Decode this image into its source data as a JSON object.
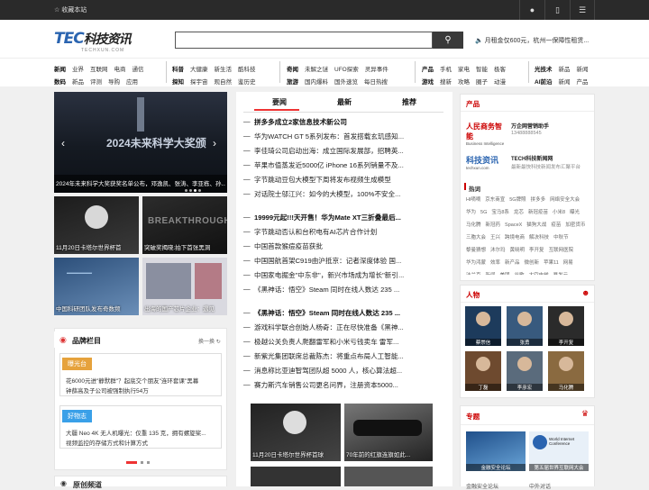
{
  "topbar": {
    "fav": "☆ 收藏本站",
    "wechat_icon": "wechat-icon",
    "mobile_icon": "mobile-icon",
    "menu_icon": "menu-icon"
  },
  "header": {
    "logo_tec": "TEC",
    "logo_cn": "科技资讯",
    "logo_small": "TECHXUN.COM",
    "search_placeholder": "",
    "notice": "月租金仅600元，杭州一保障性租赁..."
  },
  "nav": {
    "row1a": [
      "新闻",
      "业界",
      "互联网",
      "电商",
      "通信"
    ],
    "row2a": [
      "数码",
      "新品",
      "评测",
      "导购",
      "应用"
    ],
    "row1b": [
      "科普",
      "大健康",
      "新生活",
      "酷科技"
    ],
    "row2b": [
      "探知",
      "探宇宙",
      "观自然",
      "鉴历史"
    ],
    "row1c": [
      "奇闻",
      "未解之谜",
      "UFO探索",
      "灵异事件"
    ],
    "row2c": [
      "旅游",
      "国内爆料",
      "国外速览",
      "每日热搜"
    ],
    "row1d": [
      "产品",
      "手机",
      "家电",
      "智能",
      "极客"
    ],
    "row2d": [
      "游戏",
      "搜新",
      "攻略",
      "圈子",
      "动漫"
    ],
    "row1e": [
      "光技术",
      "新品",
      "新闻"
    ],
    "row2e": [
      "AI前沿",
      "新闻",
      "产品"
    ]
  },
  "carousel": {
    "bigtext": "2024未来科学大奖颁",
    "caption": "2024年未来科学大奖获奖名单公布，邓逸凯、张涛、李亚栋、孙..."
  },
  "thumbs": [
    {
      "cap": "11月20日卡塔尔世界杯首"
    },
    {
      "cap": "突破奖揭晓:拍下首张黑洞"
    },
    {
      "cap": "中国科研团队发布奇数频"
    },
    {
      "cap": "出海的国产芯片企业：遇见"
    }
  ],
  "brand": {
    "title": "品牌栏目",
    "switch": "换一换",
    "boxes": [
      {
        "tag": "曝光台",
        "lines": [
          "花6000元进\"静默群\"？起底交个朋友\"连环套课\"黑幕",
          "钟薛高及子公司被强制执行54万"
        ]
      },
      {
        "tag": "好物志",
        "lines": [
          "大疆 Neo 4K 无人机曝光：仅重 135 克，拥有螺旋桨...",
          "视频监控的存储方式和计算方式"
        ]
      }
    ],
    "next": "原创频道"
  },
  "tabs": [
    "要闻",
    "最新",
    "推荐"
  ],
  "news1": [
    "拼多多成立2家信息技术新公司",
    "华为WATCH GT 5系列发布：首发搭载玄玑感知...",
    "李佳琦公司启动出海：成立国际发展部，招聘英...",
    "苹果市值蒸发近5000亿 iPhone 16系列销量不及...",
    "字节跳动豆包大模型下周将发布视频生成模型",
    "对话院士邬江兴：如今的大模型，100%不安全..."
  ],
  "news2": [
    "19999元起!!!天开售！华为Mate XT三折叠最后...",
    "字节跳动否认和台积电有AI芯片合作计划",
    "中国首款猴痘疫苗获批",
    "中国国航首架C919由沪抵京：记者深度体验 国...",
    "中国家电掘金\"中东非\"，新兴市场成为增长\"新引...",
    "《黑神话：悟空》Steam 同时在线人数达 235 ..."
  ],
  "news3": [
    "《黑神话：悟空》Steam 同时在线人数达 235 ...",
    "游戏科学联合创始人杨奇：正在尽快准备《黑神...",
    "极越公关负责人爬翻雷军和小米亏钱卖车 雷军...",
    "新紫光集团联席总裁陈杰：将重点布局人工智能...",
    "消息称比亚迪智驾团队超 5000 人，核心算法超...",
    "赛力斯汽车销售公司更名问界，注册资本5000..."
  ],
  "bottomthumbs": [
    {
      "cap": "11月20日卡塔尔世界杯首球"
    },
    {
      "cap": "70年前的红旗连旗如此..."
    }
  ],
  "right": {
    "product": "产品",
    "p1name": "万企网营销助手",
    "p1desc": "13488888545",
    "p1logo": "人民商务智能",
    "p1sub": "Business Intelligence",
    "p2name": "TECH科技新闻网",
    "p2desc": "最新最快科技新闻发布汇聚平台",
    "p2logo": "科技资讯",
    "hottitle": "热词",
    "tags": [
      "Hi嘀嘀",
      "京东商宣",
      "5G牌照",
      "拼多多",
      "网络安全大会",
      "华为",
      "5G",
      "宝马8系",
      "龙芯",
      "新冠疫苗",
      "小米8",
      "曝光",
      "马化腾",
      "新冠药",
      "SpaceX",
      "猫狗大战",
      "疫苗",
      "加密货币",
      "三胞大会",
      "王兴",
      "跨境电商",
      "解决科技",
      "中秋节",
      "黎曼猜想",
      "沐尔玛",
      "黄晓明",
      "李开复",
      "互联网医院",
      "华为鸿蒙",
      "效率",
      "新产品",
      "微创新",
      "苹果11",
      "网易",
      "法兰克",
      "新闻",
      "美团",
      "谷歌",
      "太空电梯",
      "暴发元"
    ],
    "persontitle": "人物",
    "persons": [
      "蔡崇信",
      "张勇",
      "李开复",
      "丁磊",
      "李彦宏",
      "马化腾"
    ],
    "topictitle": "专题",
    "topics": [
      "金融安全论坛",
      "第五届世界互联网大会"
    ],
    "topiccap": [
      "金融安全论坛",
      "中外对话"
    ]
  }
}
